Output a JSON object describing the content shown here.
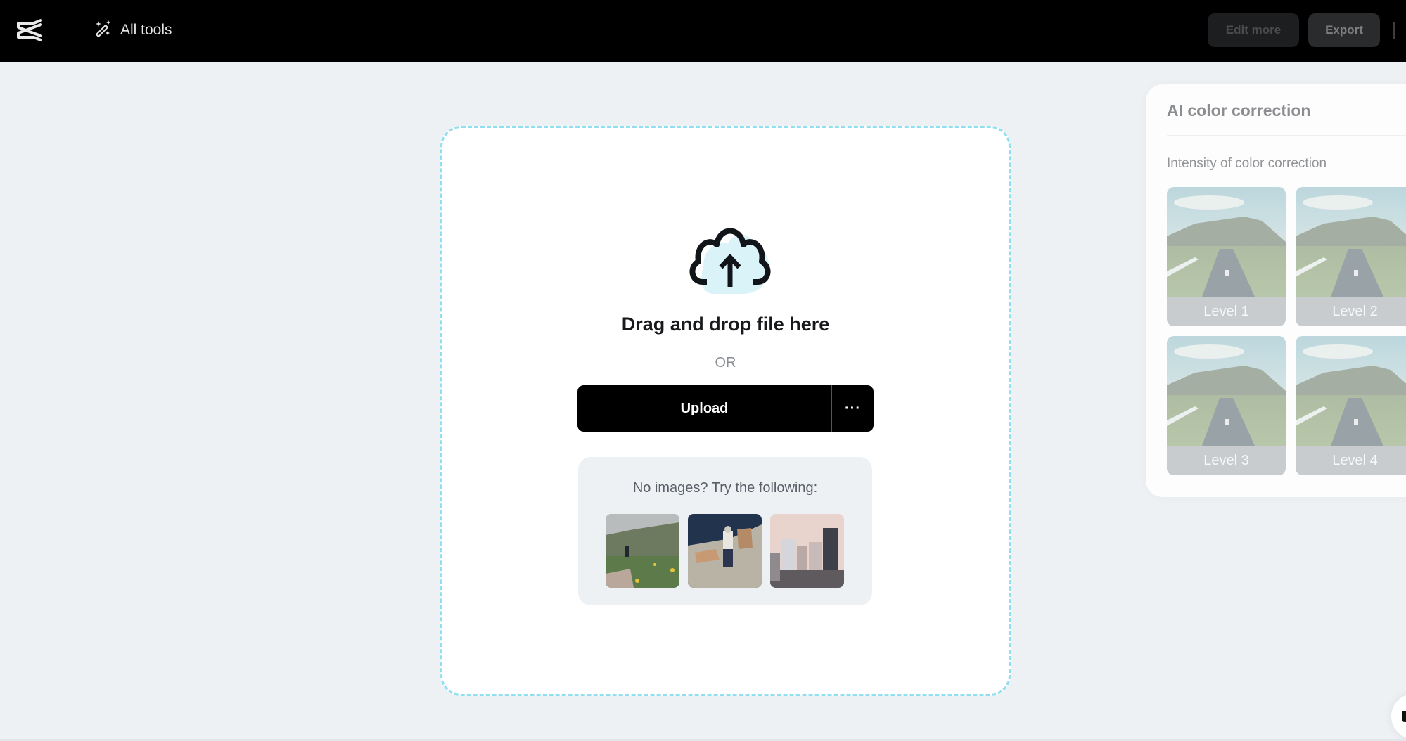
{
  "header": {
    "logo_icon": "capcut-logo-icon",
    "all_tools_icon": "magic-wand-icon",
    "all_tools_label": "All tools",
    "edit_more_label": "Edit more",
    "export_label": "Export"
  },
  "dropzone": {
    "icon": "cloud-upload-icon",
    "title": "Drag and drop file here",
    "or_text": "OR",
    "upload_label": "Upload",
    "more_label": "···",
    "samples": {
      "title": "No images? Try the following:",
      "items": [
        {
          "name": "sample-mountain-hiker"
        },
        {
          "name": "sample-seaside-people"
        },
        {
          "name": "sample-city-skyline"
        }
      ]
    }
  },
  "panel": {
    "title": "AI color correction",
    "subtitle": "Intensity of color correction",
    "levels": [
      {
        "label": "Level 1"
      },
      {
        "label": "Level 2"
      },
      {
        "label": "Level 3"
      },
      {
        "label": "Level 4"
      }
    ]
  },
  "colors": {
    "header_bg": "#000000",
    "page_bg": "#eef1f4",
    "dropzone_border": "#8fdff0",
    "upload_bg": "#000000"
  }
}
